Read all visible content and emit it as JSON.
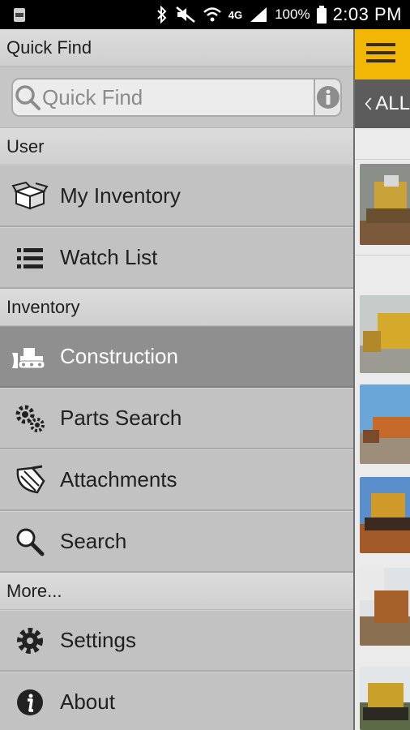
{
  "status_bar": {
    "battery_percent": "100%",
    "time": "2:03 PM",
    "network": "4G"
  },
  "drawer": {
    "sections": {
      "quick_find": "Quick Find",
      "user": "User",
      "inventory": "Inventory",
      "more": "More..."
    },
    "search": {
      "placeholder": "Quick Find"
    },
    "user_items": [
      {
        "label": "My Inventory",
        "icon": "box-icon"
      },
      {
        "label": "Watch List",
        "icon": "list-icon"
      }
    ],
    "inventory_items": [
      {
        "label": "Construction",
        "icon": "bulldozer-icon",
        "active": true
      },
      {
        "label": "Parts Search",
        "icon": "gears-icon"
      },
      {
        "label": "Attachments",
        "icon": "bucket-icon"
      },
      {
        "label": "Search",
        "icon": "search-icon"
      }
    ],
    "more_items": [
      {
        "label": "Settings",
        "icon": "gear-icon"
      },
      {
        "label": "About",
        "icon": "info-icon"
      }
    ]
  },
  "app": {
    "subbar_label": "ALL",
    "colors": {
      "toolbar": "#f2b705",
      "subbar": "#5c5c5c",
      "active_item": "#8f8f8f"
    }
  }
}
